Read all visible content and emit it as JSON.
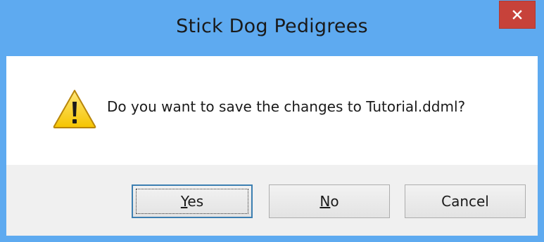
{
  "window": {
    "title": "Stick Dog Pedigrees",
    "close_icon": "close-icon",
    "titlebar_color": "#5eaaf0",
    "close_color": "#c7423a"
  },
  "message": {
    "icon": "warning-icon",
    "text": "Do you want to save the changes to Tutorial.ddml?"
  },
  "buttons": {
    "yes": {
      "accel": "Y",
      "rest": "es",
      "default": true
    },
    "no": {
      "accel": "N",
      "rest": "o"
    },
    "cancel": {
      "label": "Cancel"
    }
  }
}
